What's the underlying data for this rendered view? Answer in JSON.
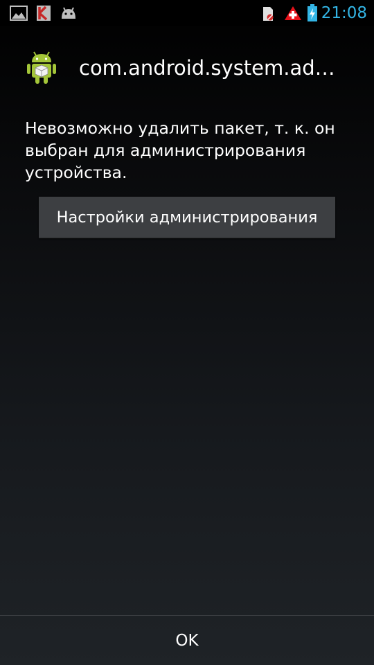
{
  "status_bar": {
    "time": "21:08",
    "time_color": "#33b5e5",
    "left_icons": [
      "gallery-icon",
      "kaspersky-icon",
      "android-debug-icon"
    ],
    "right_icons": [
      "sd-card-icon",
      "warning-icon",
      "battery-charging-icon"
    ]
  },
  "dialog": {
    "app_icon": "android-package-icon",
    "title": "com.android.system.ad…",
    "message": "Невозможно удалить пакет, т. к. он выбран для администрирования устройства.",
    "admin_button_label": "Настройки администрирования",
    "ok_button_label": "OK"
  },
  "colors": {
    "android_green": "#a4c639",
    "warning_red": "#e8121a",
    "button_bg": "#3d3f42"
  }
}
